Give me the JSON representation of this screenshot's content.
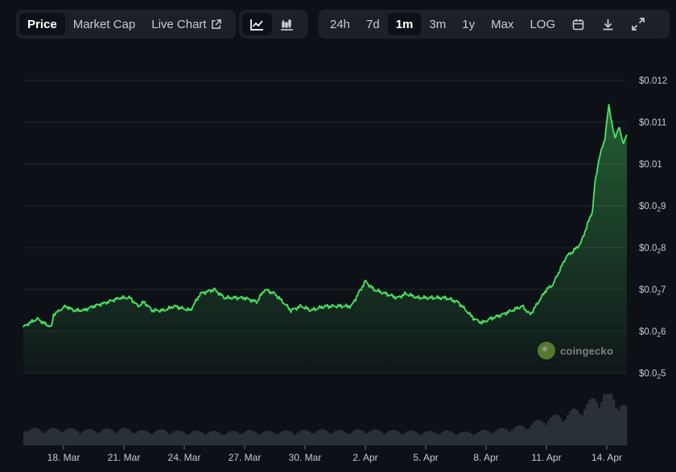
{
  "toolbar": {
    "metric_tabs": [
      {
        "label": "Price",
        "active": true
      },
      {
        "label": "Market Cap",
        "active": false
      },
      {
        "label": "Live Chart",
        "active": false
      }
    ],
    "chart_types": [
      {
        "icon": "line-chart-icon",
        "active": true
      },
      {
        "icon": "candlestick-chart-icon",
        "active": false
      }
    ],
    "ranges": [
      {
        "label": "24h",
        "active": false
      },
      {
        "label": "7d",
        "active": false
      },
      {
        "label": "1m",
        "active": true
      },
      {
        "label": "3m",
        "active": false
      },
      {
        "label": "1y",
        "active": false
      },
      {
        "label": "Max",
        "active": false
      },
      {
        "label": "LOG",
        "active": false
      }
    ],
    "tools": [
      "calendar-icon",
      "download-icon",
      "fullscreen-icon"
    ]
  },
  "watermark": "coingecko",
  "colors": {
    "line": "#4ade62",
    "volume": "#2a3038",
    "grid": "#232a23",
    "background": "#0d1117"
  },
  "chart_data": {
    "type": "line",
    "series_note": "",
    "y_ticks": [
      {
        "prefix": "$0.0",
        "sub": "2",
        "rest": "5",
        "value": 0.0025
      },
      {
        "prefix": "$0.0",
        "sub": "2",
        "rest": "6",
        "value": 0.0026
      },
      {
        "prefix": "$0.0",
        "sub": "2",
        "rest": "7",
        "value": 0.0027
      },
      {
        "prefix": "$0.0",
        "sub": "2",
        "rest": "8",
        "value": 0.0028
      },
      {
        "prefix": "$0.0",
        "sub": "2",
        "rest": "9",
        "value": 0.0029
      },
      {
        "prefix": "$0.01",
        "sub": "",
        "rest": "",
        "value": 0.003
      },
      {
        "prefix": "$0.011",
        "sub": "",
        "rest": "",
        "value": 0.0031
      },
      {
        "prefix": "$0.012",
        "sub": "",
        "rest": "",
        "value": 0.0032
      }
    ],
    "ylim": [
      0.0025,
      0.0032
    ],
    "x_ticks": [
      "18. Mar",
      "21. Mar",
      "24. Mar",
      "27. Mar",
      "30. Mar",
      "2. Apr",
      "5. Apr",
      "8. Apr",
      "11. Apr",
      "14. Apr"
    ],
    "x_tick_days": [
      2,
      5,
      8,
      11,
      14,
      17,
      20,
      23,
      26,
      29
    ],
    "xlim_days": [
      0,
      30
    ],
    "price_points": [
      [
        0.0,
        0.00261
      ],
      [
        0.3,
        0.00262
      ],
      [
        0.7,
        0.00263
      ],
      [
        1.0,
        0.00262
      ],
      [
        1.4,
        0.00261
      ],
      [
        1.5,
        0.00264
      ],
      [
        1.8,
        0.00265
      ],
      [
        2.1,
        0.00266
      ],
      [
        2.5,
        0.00265
      ],
      [
        3.0,
        0.00265
      ],
      [
        3.5,
        0.00266
      ],
      [
        4.2,
        0.00267
      ],
      [
        4.8,
        0.00268
      ],
      [
        5.3,
        0.00268
      ],
      [
        5.7,
        0.00266
      ],
      [
        6.0,
        0.00267
      ],
      [
        6.4,
        0.00265
      ],
      [
        7.0,
        0.00265
      ],
      [
        7.5,
        0.00266
      ],
      [
        8.3,
        0.00265
      ],
      [
        8.8,
        0.00269
      ],
      [
        9.5,
        0.0027
      ],
      [
        10.0,
        0.00268
      ],
      [
        10.5,
        0.00268
      ],
      [
        11.0,
        0.00268
      ],
      [
        11.6,
        0.00267
      ],
      [
        12.0,
        0.0027
      ],
      [
        12.5,
        0.00269
      ],
      [
        12.9,
        0.00267
      ],
      [
        13.3,
        0.00265
      ],
      [
        13.8,
        0.00266
      ],
      [
        14.3,
        0.00265
      ],
      [
        15.0,
        0.00266
      ],
      [
        15.8,
        0.00266
      ],
      [
        16.3,
        0.00266
      ],
      [
        17.0,
        0.00272
      ],
      [
        17.4,
        0.0027
      ],
      [
        18.0,
        0.00269
      ],
      [
        18.6,
        0.00268
      ],
      [
        19.0,
        0.00269
      ],
      [
        19.6,
        0.00268
      ],
      [
        20.3,
        0.00268
      ],
      [
        21.0,
        0.00268
      ],
      [
        21.6,
        0.00267
      ],
      [
        22.0,
        0.00265
      ],
      [
        22.4,
        0.00263
      ],
      [
        22.8,
        0.00262
      ],
      [
        23.2,
        0.00263
      ],
      [
        23.8,
        0.00264
      ],
      [
        24.3,
        0.00265
      ],
      [
        24.8,
        0.00266
      ],
      [
        25.2,
        0.00264
      ],
      [
        25.6,
        0.00267
      ],
      [
        26.0,
        0.0027
      ],
      [
        26.3,
        0.00271
      ],
      [
        26.6,
        0.00274
      ],
      [
        27.0,
        0.00278
      ],
      [
        27.3,
        0.00279
      ],
      [
        27.7,
        0.00281
      ],
      [
        28.0,
        0.00285
      ],
      [
        28.3,
        0.00289
      ],
      [
        28.4,
        0.00295
      ],
      [
        28.6,
        0.00301
      ],
      [
        28.9,
        0.00306
      ],
      [
        29.1,
        0.00314
      ],
      [
        29.4,
        0.00306
      ],
      [
        29.6,
        0.00309
      ],
      [
        29.8,
        0.00305
      ],
      [
        30.0,
        0.00307
      ]
    ],
    "volume_points": [
      [
        0.0,
        0.3
      ],
      [
        1.0,
        0.28
      ],
      [
        2.0,
        0.3
      ],
      [
        3.0,
        0.27
      ],
      [
        4.0,
        0.28
      ],
      [
        5.0,
        0.29
      ],
      [
        6.0,
        0.25
      ],
      [
        7.0,
        0.27
      ],
      [
        8.0,
        0.24
      ],
      [
        9.0,
        0.25
      ],
      [
        10.0,
        0.23
      ],
      [
        11.0,
        0.26
      ],
      [
        12.0,
        0.24
      ],
      [
        13.0,
        0.25
      ],
      [
        14.0,
        0.26
      ],
      [
        15.0,
        0.27
      ],
      [
        16.0,
        0.25
      ],
      [
        17.0,
        0.27
      ],
      [
        18.0,
        0.26
      ],
      [
        19.0,
        0.25
      ],
      [
        20.0,
        0.24
      ],
      [
        21.0,
        0.25
      ],
      [
        22.0,
        0.23
      ],
      [
        23.0,
        0.26
      ],
      [
        24.0,
        0.3
      ],
      [
        25.0,
        0.35
      ],
      [
        26.0,
        0.48
      ],
      [
        27.0,
        0.55
      ],
      [
        28.0,
        0.72
      ],
      [
        28.5,
        0.85
      ],
      [
        29.0,
        0.95
      ],
      [
        29.5,
        0.8
      ],
      [
        30.0,
        0.65
      ]
    ]
  }
}
